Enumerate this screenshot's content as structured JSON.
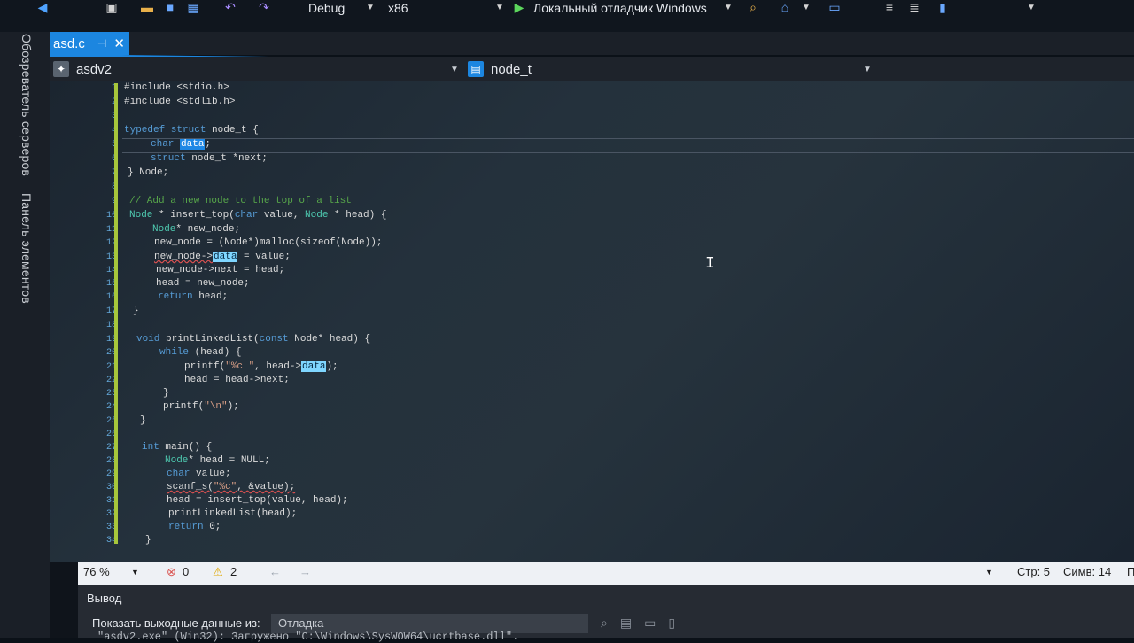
{
  "toolbar": {
    "config": "Debug",
    "platform": "x86",
    "debugger": "Локальный отладчик Windows"
  },
  "side_tabs": [
    "Обозреватель серверов",
    "Панель элементов"
  ],
  "document_tab": {
    "name": "asd.c",
    "pin": "⊣",
    "close": "✕"
  },
  "nav": {
    "project": "asdv2",
    "scope": "node_t"
  },
  "line_numbers": [
    "1",
    "2",
    "3",
    "4",
    "5",
    "6",
    "7",
    "8",
    "9",
    "10",
    "11",
    "12",
    "13",
    "14",
    "15",
    "16",
    "17",
    "18",
    "19",
    "20",
    "21",
    "22",
    "23",
    "24",
    "25",
    "26",
    "27",
    "28",
    "29",
    "30",
    "31",
    "32",
    "33",
    "34"
  ],
  "code": {
    "l1": "#include <stdio.h>",
    "l2": "#include <stdlib.h>",
    "l4_kw": "typedef struct",
    "l4_rest": " node_t {",
    "l5_kw": "char",
    "l5_hl": "data",
    "l5_rest": ";",
    "l6_kw": "struct",
    "l6_rest": " node_t *next;",
    "l7": "} Node;",
    "l9": "// Add a new node to the top of a list",
    "l10_ty": "Node",
    "l10_a": " * insert_top(",
    "l10_kw": "char",
    "l10_b": " value, ",
    "l10_ty2": "Node",
    "l10_c": " * head) {",
    "l11_ty": "Node",
    "l11_rest": "* new_node;",
    "l12": "new_node = (Node*)malloc(sizeof(Node));",
    "l13_a": "new_node->",
    "l13_hl": "data",
    "l13_b": " = value;",
    "l14": "new_node->next = head;",
    "l15": "head = new_node;",
    "l16_kw": "return",
    "l16_rest": " head;",
    "l17": "}",
    "l19_kw": "void",
    "l19_a": " printLinkedList(",
    "l19_kw2": "const",
    "l19_b": " Node* head) {",
    "l20_kw": "while",
    "l20_rest": " (head) {",
    "l21_a": "printf(",
    "l21_st": "\"%c \"",
    "l21_b": ", head->",
    "l21_hl": "data",
    "l21_c": ");",
    "l22": "head = head->next;",
    "l23": "}",
    "l24_a": "printf(",
    "l24_st": "\"\\n\"",
    "l24_b": ");",
    "l25": "}",
    "l27_kw": "int",
    "l27_rest": " main() {",
    "l28_ty": "Node",
    "l28_rest": "* head = NULL;",
    "l29_kw": "char",
    "l29_rest": " value;",
    "l30_a": "scanf_s(",
    "l30_st": "\"%c\"",
    "l30_b": ", &value);",
    "l31": "head = insert_top(value, head);",
    "l32": "printLinkedList(head);",
    "l33_kw": "return",
    "l33_rest": " 0;",
    "l34": "}"
  },
  "status": {
    "zoom": "76 %",
    "errors": "0",
    "warnings": "2",
    "line": "Стр: 5",
    "col": "Симв: 14",
    "extra": "П"
  },
  "output": {
    "title": "Вывод",
    "show_label": "Показать выходные данные из:",
    "source": "Отладка",
    "text": "\"asdv2.exe\" (Win32): Загружено \"C:\\Windows\\SysWOW64\\ucrtbase.dll\"."
  }
}
